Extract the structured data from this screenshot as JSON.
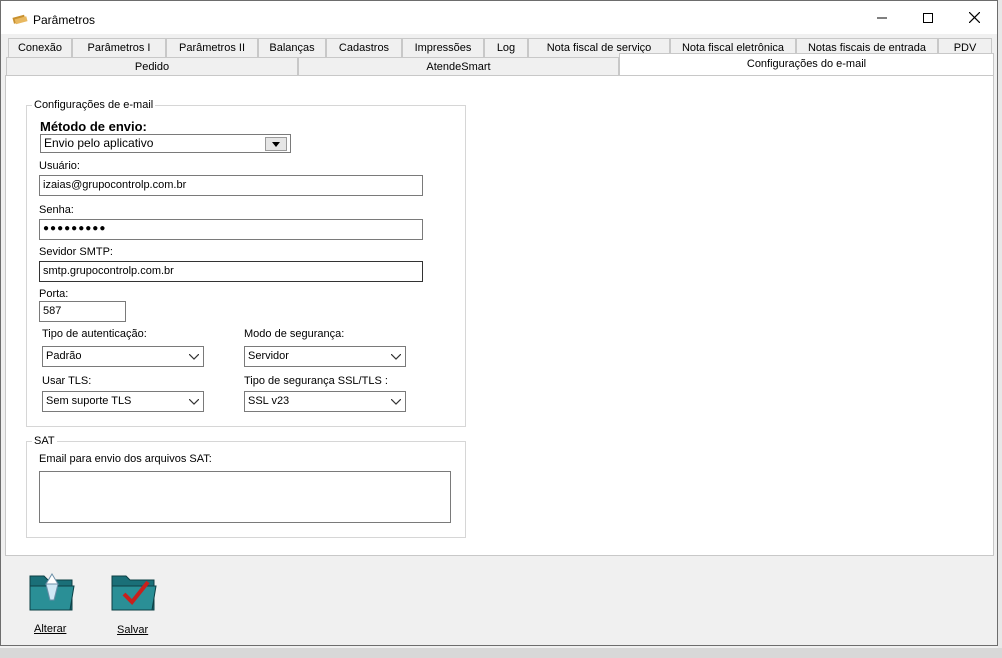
{
  "window": {
    "title": "Parâmetros"
  },
  "tabs_row1": [
    "Conexão",
    "Parâmetros I",
    "Parâmetros II",
    "Balanças",
    "Cadastros",
    "Impressões",
    "Log",
    "Nota fiscal de serviço",
    "Nota fiscal eletrônica",
    "Notas fiscais de entrada",
    "PDV"
  ],
  "tabs_row2": [
    "Pedido",
    "AtendeSmart",
    "Configurações do e-mail"
  ],
  "email_group": {
    "legend": "Configurações de e-mail",
    "send_method_label": "Método de envio:",
    "send_method_value": "Envio pelo aplicativo",
    "user_label": "Usuário:",
    "user_value": "izaias@grupocontrolp.com.br",
    "password_label": "Senha:",
    "password_value": "●●●●●●●●●",
    "smtp_label": "Sevidor SMTP:",
    "smtp_value": "smtp.grupocontrolp.com.br",
    "port_label": "Porta:",
    "port_value": "587",
    "auth_type_label": "Tipo de autenticação:",
    "auth_type_value": "Padrão",
    "security_mode_label": "Modo de segurança:",
    "security_mode_value": "Servidor",
    "use_tls_label": "Usar TLS:",
    "use_tls_value": "Sem suporte TLS",
    "ssl_type_label": "Tipo de segurança SSL/TLS :",
    "ssl_type_value": "SSL v23"
  },
  "sat_group": {
    "legend": "SAT",
    "email_label": "Email para envio dos arquivos SAT:",
    "email_value": ""
  },
  "actions": {
    "alterar": "Alterar",
    "salvar": "Salvar"
  }
}
